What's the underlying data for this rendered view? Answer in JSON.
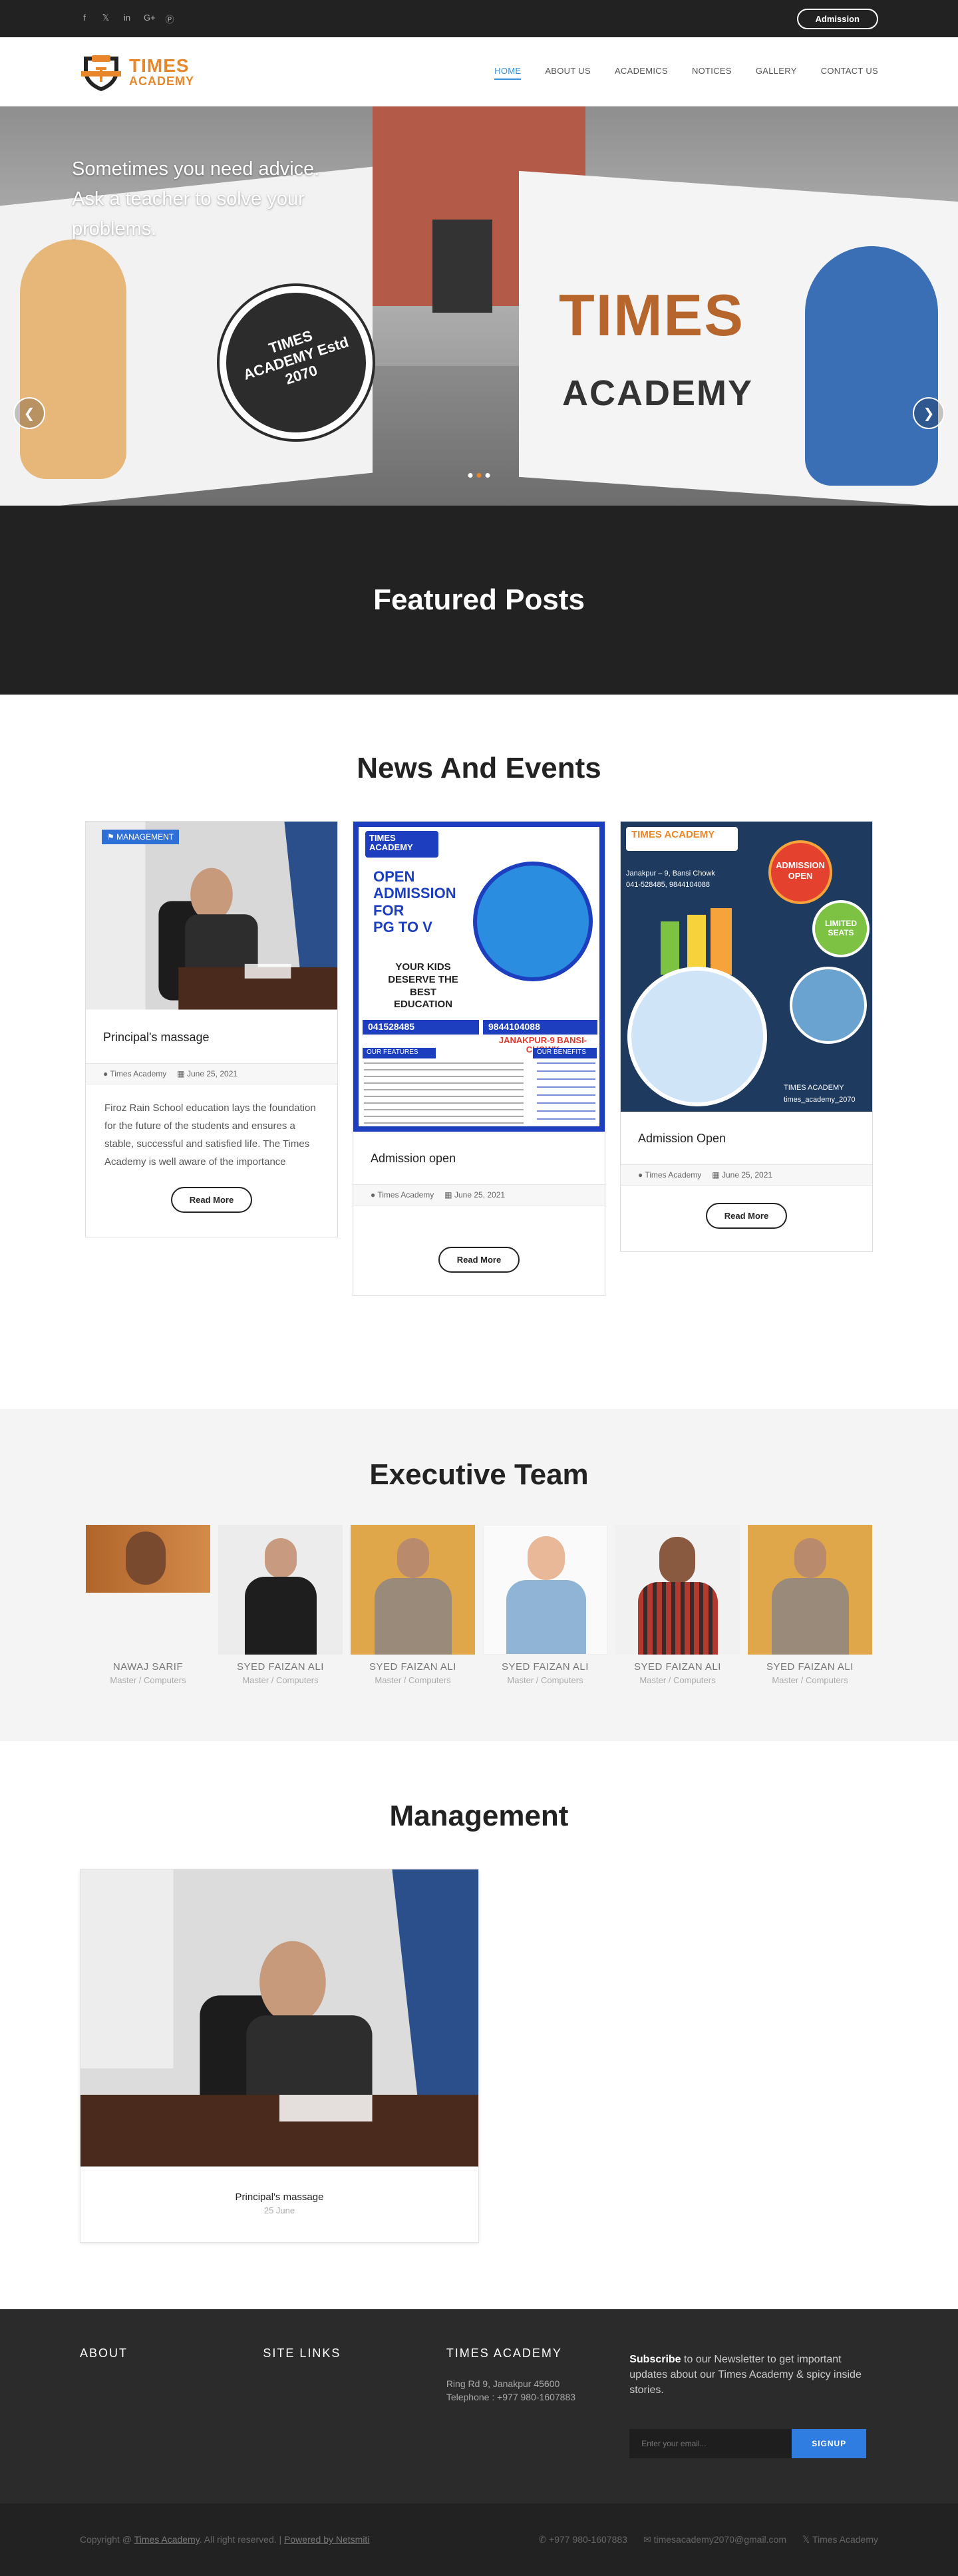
{
  "topbar": {
    "social_icons": [
      "facebook-icon",
      "twitter-icon",
      "linkedin-icon",
      "google-plus-icon",
      "pinterest-icon"
    ],
    "admission_label": "Admission"
  },
  "header": {
    "logo_line1": "TIMES",
    "logo_line2": "ACADEMY",
    "nav": [
      {
        "label": "HOME",
        "active": true
      },
      {
        "label": "ABOUT US",
        "active": false
      },
      {
        "label": "ACADEMICS",
        "active": false
      },
      {
        "label": "NOTICES",
        "active": false
      },
      {
        "label": "GALLERY",
        "active": false
      },
      {
        "label": "CONTACT US",
        "active": false
      }
    ]
  },
  "hero": {
    "caption": "Sometimes you need advice. Ask a teacher to solve your problems.",
    "emblem_text": "TIMES ACADEMY Estd 2070",
    "sign_line1": "TIMES",
    "sign_line2": "ACADEMY",
    "slides": 3,
    "active_slide": 2
  },
  "featured": {
    "title": "Featured Posts"
  },
  "news": {
    "title": "News And Events",
    "cards": [
      {
        "tag": "MANAGEMENT",
        "title": "Principal's massage",
        "author": "Times Academy",
        "date": "June 25, 2021",
        "excerpt": "Firoz Rain School education lays the foundation for the future of the students and ensures a stable, successful and satisfied life. The Times Academy is well aware of the importance",
        "button": "Read More"
      },
      {
        "title": "Admission open",
        "author": "Times Academy",
        "date": "June 25, 2021",
        "button": "Read More",
        "poster": {
          "brand": "TIMES ACADEMY",
          "headline1": "OPEN",
          "headline2": "ADMISSION",
          "headline3": "FOR",
          "headline4": "PG TO V",
          "slogan": "YOUR KIDS DESERVE THE BEST EDUCATION",
          "phone1": "041528485",
          "phone2": "9844104088",
          "location": "JANAKPUR-9 BANSI-CHOWK",
          "features_title": "OUR FEATURES",
          "benefits_title": "OUR BENEFITS"
        }
      },
      {
        "title": "Admission Open",
        "author": "Times Academy",
        "date": "June 25, 2021",
        "button": "Read More",
        "poster": {
          "brand": "TIMES ACADEMY",
          "address": "Janakpur – 9, Bansi Chowk",
          "phones": "041-528485, 9844104088",
          "badge1": "ADMISSION OPEN",
          "badge2": "LIMITED SEATS",
          "footer1": "TIMES ACADEMY",
          "footer2": "times_academy_2070"
        }
      }
    ]
  },
  "team": {
    "title": "Executive Team",
    "members": [
      {
        "name": "NAWAJ SARIF",
        "role": "Master / Computers"
      },
      {
        "name": "SYED FAIZAN ALI",
        "role": "Master / Computers"
      },
      {
        "name": "SYED FAIZAN ALI",
        "role": "Master / Computers"
      },
      {
        "name": "SYED FAIZAN ALI",
        "role": "Master / Computers"
      },
      {
        "name": "SYED FAIZAN ALI",
        "role": "Master / Computers"
      },
      {
        "name": "SYED FAIZAN ALI",
        "role": "Master / Computers"
      }
    ]
  },
  "management": {
    "title": "Management",
    "card": {
      "name": "Principal's massage",
      "date": "25 June"
    }
  },
  "footer": {
    "about_title": "ABOUT",
    "links_title": "SITE LINKS",
    "academy_title": "TIMES ACADEMY",
    "address": "Ring Rd 9, Janakpur 45600",
    "telephone": "Telephone : +977 980-1607883",
    "newsletter_bold": "Subscribe",
    "newsletter_text": " to our Newsletter to get important updates about our Times Academy & spicy inside stories.",
    "email_placeholder": "Enter your email...",
    "signup_label": "SIGNUP"
  },
  "bottombar": {
    "copyright_prefix": "Copyright @ ",
    "copyright_link": "Times Academy",
    "copyright_mid": ". All right reserved. | ",
    "powered_link": "Powered by Netsmiti",
    "phone": "+977 980-1607883",
    "email": "timesacademy2070@gmail.com",
    "twitter": "Times Academy"
  },
  "colors": {
    "accent": "#e8862a",
    "link": "#3a8fd9",
    "dark": "#222222",
    "button_blue": "#2f7de1"
  }
}
